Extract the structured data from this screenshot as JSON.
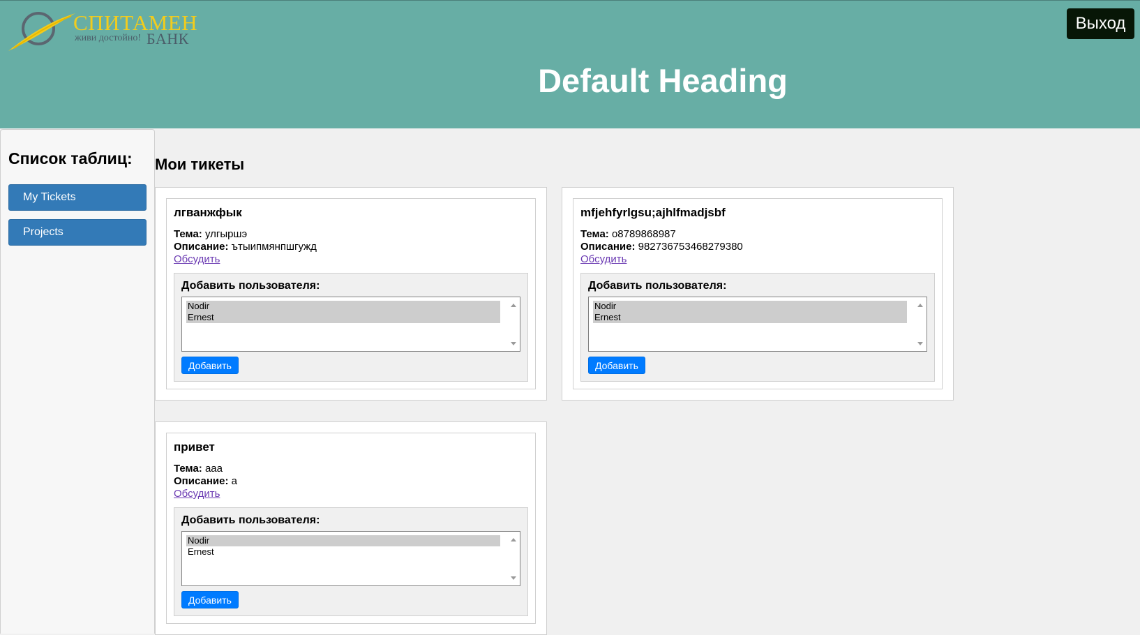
{
  "header": {
    "logo": {
      "name": "СПИТАМЕН",
      "slogan": "живи достойно!",
      "bank": "БАНК"
    },
    "title": "Default Heading",
    "logout_label": "Выход"
  },
  "sidebar": {
    "title": "Список таблиц:",
    "items": [
      {
        "label": "My Tickets"
      },
      {
        "label": "Projects"
      }
    ]
  },
  "main": {
    "title": "Мои тикеты",
    "labels": {
      "topic": "Тема:",
      "description": "Описание:",
      "discuss": "Обсудить",
      "add_user": "Добавить пользователя:",
      "add_button": "Добавить"
    },
    "tickets": [
      {
        "title": "лгванжфык",
        "topic": "улгыршэ",
        "description": "ътыипмянпшгужд",
        "users": [
          {
            "name": "Nodir",
            "selected": true
          },
          {
            "name": "Ernest",
            "selected": true
          }
        ]
      },
      {
        "title": "mfjehfyrlgsu;ajhlfmadjsbf",
        "topic": "o8789868987",
        "description": "982736753468279380",
        "users": [
          {
            "name": "Nodir",
            "selected": true
          },
          {
            "name": "Ernest",
            "selected": true
          }
        ]
      },
      {
        "title": "привет",
        "topic": "aaa",
        "description": "a",
        "users": [
          {
            "name": "Nodir",
            "selected": true
          },
          {
            "name": "Ernest",
            "selected": false
          }
        ]
      }
    ]
  },
  "colors": {
    "header_bg": "#67aea5",
    "logout_bg": "#071606",
    "sidebar_button": "#337ab7",
    "add_button": "#007bff",
    "logo_gold": "#f2cc1d"
  }
}
